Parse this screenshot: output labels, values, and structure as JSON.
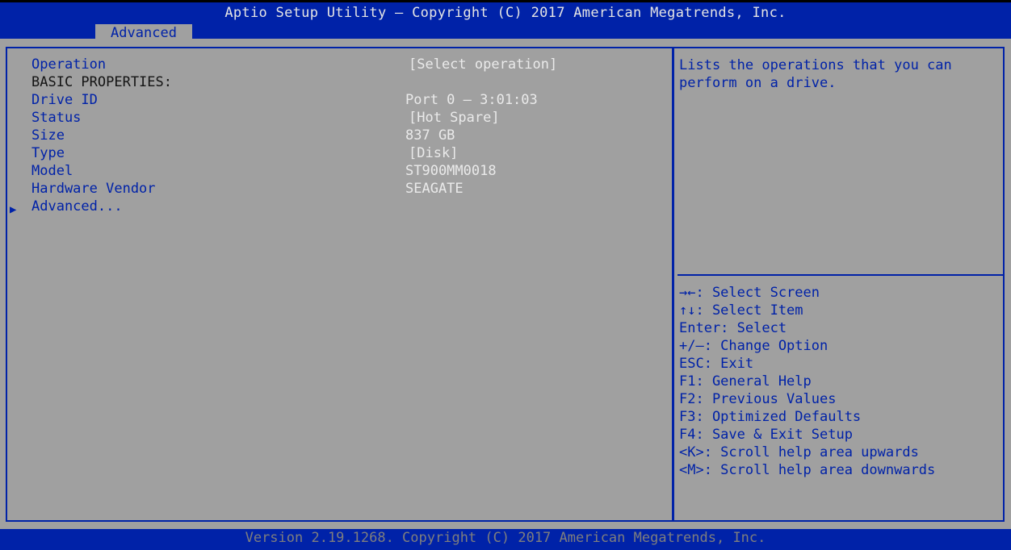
{
  "header": {
    "title": "Aptio Setup Utility – Copyright (C) 2017 American Megatrends, Inc.",
    "tab": "Advanced"
  },
  "items": [
    {
      "label": "Operation",
      "value": "[Select operation]"
    },
    {
      "label": "BASIC PROPERTIES:"
    },
    {
      "label": "Drive ID",
      "value": "Port 0 – 3:01:03"
    },
    {
      "label": "Status",
      "value": "[Hot Spare]"
    },
    {
      "label": "Size",
      "value": "837 GB"
    },
    {
      "label": "Type",
      "value": "[Disk]"
    },
    {
      "label": "Model",
      "value": "ST900MM0018"
    },
    {
      "label": "Hardware Vendor",
      "value": "SEAGATE"
    },
    {
      "label": "Advanced..."
    }
  ],
  "help": {
    "description": "Lists the operations that you can perform on a drive.",
    "keys": [
      "→←: Select Screen",
      "↑↓: Select Item",
      "Enter: Select",
      "+/–: Change Option",
      "ESC: Exit",
      "F1: General Help",
      "F2: Previous Values",
      "F3: Optimized Defaults",
      "F4: Save & Exit Setup",
      "<K>: Scroll help area upwards",
      "<M>: Scroll help area downwards"
    ]
  },
  "footer": "Version 2.19.1268. Copyright (C) 2017 American Megatrends, Inc."
}
